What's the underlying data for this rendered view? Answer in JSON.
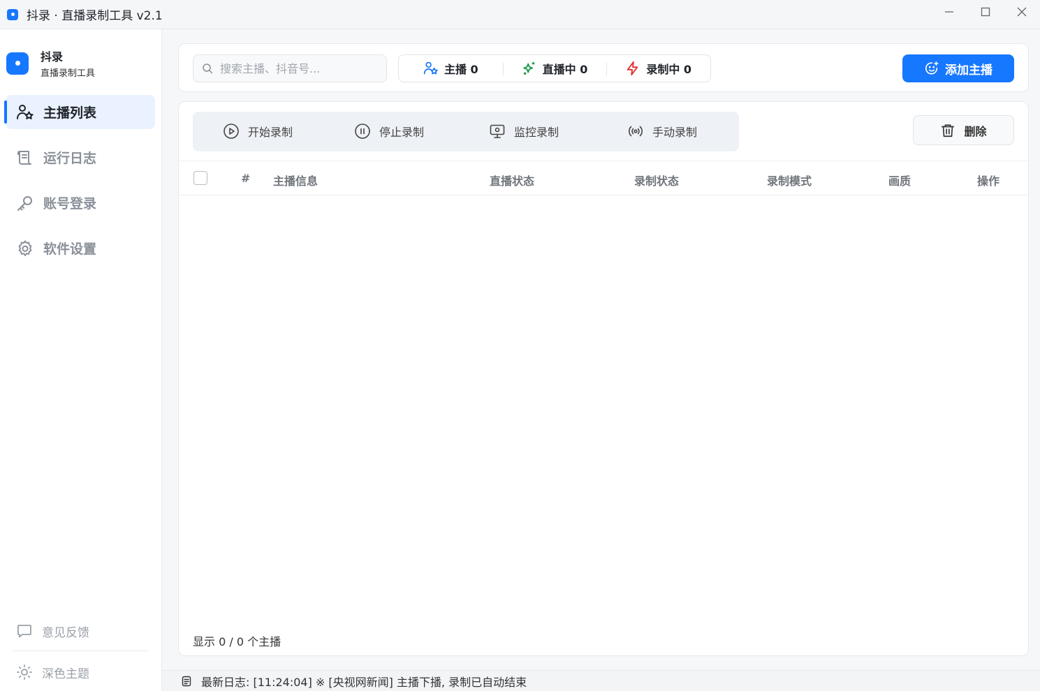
{
  "window": {
    "title": "抖录 · 直播录制工具 v2.1",
    "controls": [
      "minimize-icon",
      "maximize-icon",
      "close-icon"
    ]
  },
  "brand": {
    "name": "抖录",
    "subtitle": "直播录制工具"
  },
  "nav": {
    "items": [
      {
        "label": "主播列表",
        "icon": "users-star-icon",
        "active": true
      },
      {
        "label": "运行日志",
        "icon": "scroll-icon",
        "active": false
      },
      {
        "label": "账号登录",
        "icon": "key-icon",
        "active": false
      },
      {
        "label": "软件设置",
        "icon": "gear-icon",
        "active": false
      }
    ]
  },
  "side_bottom": {
    "feedback": "意见反馈",
    "theme": "深色主题"
  },
  "header": {
    "search_placeholder": "搜索主播、抖音号...",
    "stats": [
      {
        "label": "主播 0",
        "color": "#1677ff"
      },
      {
        "label": "直播中 0",
        "color": "#1a9a4a"
      },
      {
        "label": "录制中 0",
        "color": "#e0302f"
      }
    ],
    "add_label": "添加主播"
  },
  "toolbar": {
    "start": "开始录制",
    "stop": "停止录制",
    "monitor": "监控录制",
    "manual": "手动录制",
    "delete": "删除"
  },
  "table": {
    "columns": [
      "#",
      "主播信息",
      "直播状态",
      "录制状态",
      "录制模式",
      "画质",
      "操作"
    ],
    "rows": []
  },
  "footer": {
    "count_text": "显示 0 / 0 个主播"
  },
  "status": {
    "log_text": "最新日志: [11:24:04] ※ [央视网新闻] 主播下播, 录制已自动结束"
  },
  "colors": {
    "accent": "#1677ff",
    "live": "#1a9a4a",
    "recording": "#e0302f"
  }
}
